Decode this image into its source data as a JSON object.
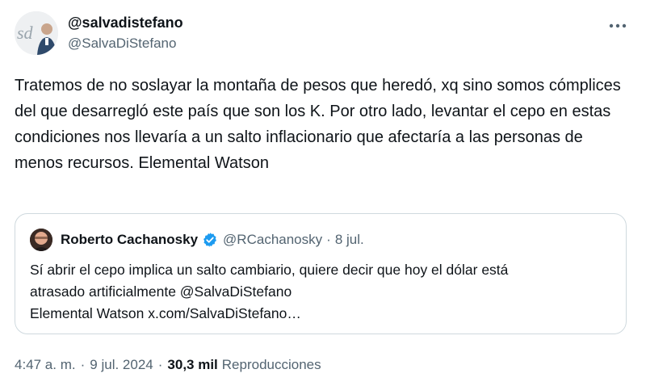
{
  "author": {
    "display_name": "@salvadistefano",
    "handle": "@SalvaDiStefano",
    "avatar_icon": "profile-photo-icon"
  },
  "more_icon": "more-options-icon",
  "tweet": {
    "text": "Tratemos de no soslayar la montaña de pesos que heredó, xq sino somos cómplices del que desarregló este país que son los K. Por otro lado, levantar el cepo en estas condiciones nos llevaría a un salto inflacionario que afectaría a las personas de menos recursos. Elemental Watson"
  },
  "quoted": {
    "name": "Roberto Cachanosky",
    "handle": "@RCachanosky",
    "separator": "·",
    "date": "8 jul.",
    "verified_icon": "verified-badge-icon",
    "text_line1": "Sí abrir el cepo implica un salto cambiario, quiere decir que hoy el dólar está",
    "text_line2": "atrasado artificialmente @SalvaDiStefano",
    "text_line3": "Elemental Watson x.com/SalvaDiStefano…"
  },
  "meta": {
    "time": "4:47 a. m.",
    "sep1": "·",
    "date": "9 jul. 2024",
    "sep2": "·",
    "views_count": "30,3 mil",
    "views_label": "Reproducciones"
  },
  "colors": {
    "text": "#0f1419",
    "secondary": "#536471",
    "border": "#cfd9de",
    "verified": "#1d9bf0"
  }
}
